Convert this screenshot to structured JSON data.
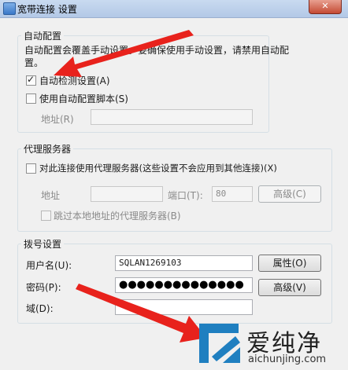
{
  "window": {
    "title": "宽带连接 设置",
    "close_label": "✕"
  },
  "auto_config": {
    "group_label": "自动配置",
    "description": "自动配置会覆盖手动设置。要确保使用手动设置，请禁用自动配置。",
    "auto_detect": {
      "label": "自动检测设置(A)",
      "checked": true
    },
    "use_script": {
      "label": "使用自动配置脚本(S)",
      "checked": false
    },
    "address_label": "地址(R)",
    "address_value": ""
  },
  "proxy": {
    "group_label": "代理服务器",
    "use_proxy": {
      "label": "对此连接使用代理服务器(这些设置不会应用到其他连接)(X)",
      "checked": false
    },
    "address_label": "地址",
    "address_value": "",
    "port_label": "端口(T):",
    "port_value": "80",
    "advanced_label": "高级(C)",
    "bypass": {
      "label": "跳过本地地址的代理服务器(B)",
      "checked": false
    }
  },
  "dialup": {
    "group_label": "拨号设置",
    "username_label": "用户名(U):",
    "username_value": "SQLAN1269103",
    "properties_label": "属性(O)",
    "password_label": "密码(P):",
    "password_value": "●●●●●●●●●●●●●●",
    "advanced_label": "高级(V)",
    "domain_label": "域(D):",
    "domain_value": ""
  },
  "watermark": {
    "brand": "爱纯净",
    "url": "aichunjing.com"
  },
  "colors": {
    "arrow": "#e8221c",
    "logo_blue": "#1f7fc0"
  }
}
